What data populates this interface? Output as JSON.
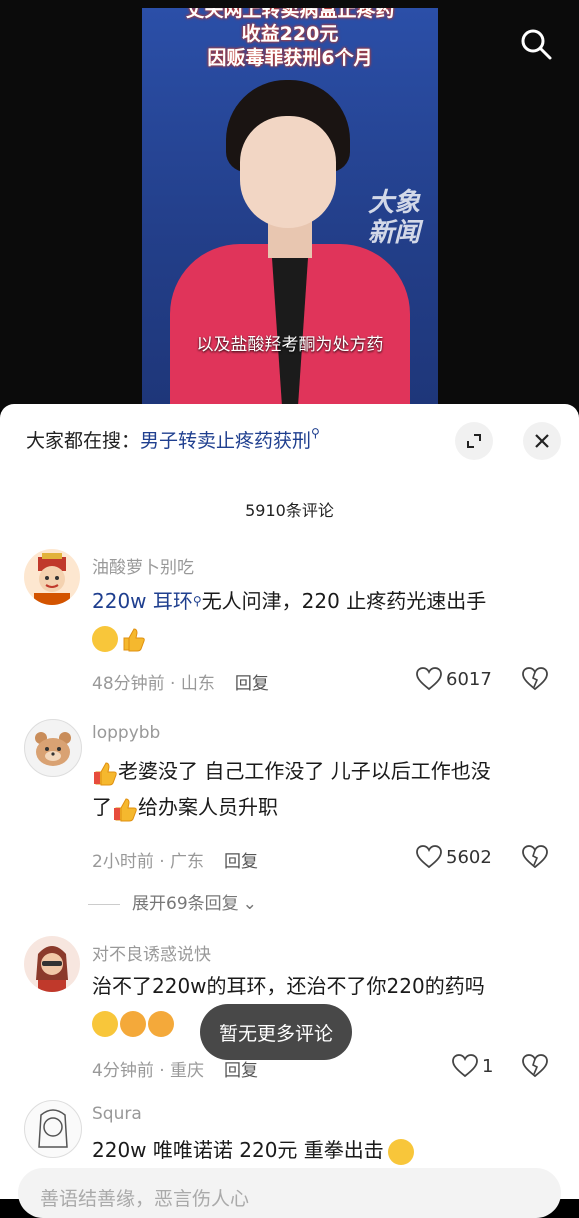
{
  "video": {
    "headline_l1": "丈夫网上转卖病盒止疼药",
    "headline_l2": "收益220元",
    "headline_l3": "因贩毒罪获刑6个月",
    "watermark_l1": "大象",
    "watermark_l2": "新闻",
    "subtitle": "以及盐酸羟考酮为处方药",
    "search_icon": "search-icon"
  },
  "sheet": {
    "search_label": "大家都在搜：",
    "search_term": "男子转卖止疼药获刑",
    "expand_icon": "expand-icon",
    "close_icon": "close-icon",
    "count": "5910条评论"
  },
  "comments": [
    {
      "user": "油酸萝卜别吃",
      "text_hl": "220w 耳环",
      "text": "无人问津，220 止疼药光速出手",
      "time": "48分钟前",
      "region": "山东",
      "reply": "回复",
      "likes": "6017"
    },
    {
      "user": "loppybb",
      "text_a": "老婆没了 自己工作没了 儿子以后工作也没",
      "text_b": "了",
      "text_c": "给办案人员升职",
      "time": "2小时前",
      "region": "广东",
      "reply": "回复",
      "likes": "5602",
      "expand": "展开69条回复"
    },
    {
      "user": "对不良诱惑说快",
      "text": "治不了220w的耳环，还治不了你220的药吗",
      "time": "4分钟前",
      "region": "重庆",
      "reply": "回复",
      "likes": "1"
    },
    {
      "user": "Squra",
      "text": "220w 唯唯诺诺 220元 重拳出击"
    }
  ],
  "toast": "暂无更多评论",
  "input": {
    "placeholder": "善语结善缘，恶言伤人心"
  },
  "colors": {
    "link": "#1f3f8f",
    "jacket": "#e0345a",
    "video_bg": "#2b4fa8"
  }
}
